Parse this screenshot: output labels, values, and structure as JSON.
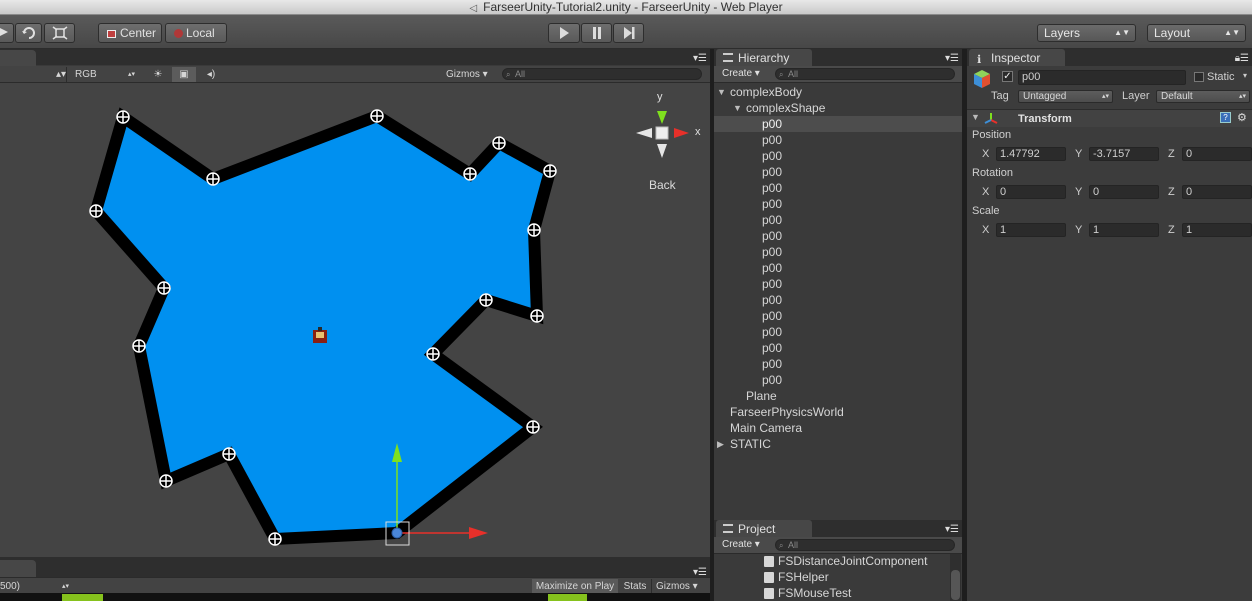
{
  "window": {
    "title": "FarseerUnity-Tutorial2.unity - FarseerUnity - Web Player"
  },
  "toolbar": {
    "pivot_center": "Center",
    "pivot_local": "Local",
    "layers": "Layers",
    "layout": "Layout"
  },
  "scene": {
    "render_mode": "RGB",
    "gizmos": "Gizmos",
    "search_placeholder": "All",
    "gizmo_y": "y",
    "gizmo_x": "x",
    "gizmo_view": "Back"
  },
  "game": {
    "resolution": "500)",
    "maximize": "Maximize on Play",
    "stats": "Stats",
    "gizmos": "Gizmos"
  },
  "hierarchy": {
    "title": "Hierarchy",
    "create": "Create",
    "search_placeholder": "All",
    "items": [
      {
        "label": "complexBody"
      },
      {
        "label": "complexShape"
      },
      {
        "label": "p00"
      },
      {
        "label": "p00"
      },
      {
        "label": "p00"
      },
      {
        "label": "p00"
      },
      {
        "label": "p00"
      },
      {
        "label": "p00"
      },
      {
        "label": "p00"
      },
      {
        "label": "p00"
      },
      {
        "label": "p00"
      },
      {
        "label": "p00"
      },
      {
        "label": "p00"
      },
      {
        "label": "p00"
      },
      {
        "label": "p00"
      },
      {
        "label": "p00"
      },
      {
        "label": "p00"
      },
      {
        "label": "p00"
      },
      {
        "label": "p00"
      },
      {
        "label": "Plane"
      },
      {
        "label": "FarseerPhysicsWorld"
      },
      {
        "label": "Main Camera"
      },
      {
        "label": "STATIC"
      }
    ]
  },
  "project": {
    "title": "Project",
    "create": "Create",
    "search_placeholder": "All",
    "items": [
      {
        "label": "FSDistanceJointComponent"
      },
      {
        "label": "FSHelper"
      },
      {
        "label": "FSMouseTest"
      }
    ]
  },
  "inspector": {
    "title": "Inspector",
    "object_name": "p00",
    "static_label": "Static",
    "tag_label": "Tag",
    "tag_value": "Untagged",
    "layer_label": "Layer",
    "layer_value": "Default",
    "transform_title": "Transform",
    "position_label": "Position",
    "rotation_label": "Rotation",
    "scale_label": "Scale",
    "axis_x": "X",
    "axis_y": "Y",
    "axis_z": "Z",
    "position": {
      "x": "1.47792",
      "y": "-3.7157",
      "z": "0"
    },
    "rotation": {
      "x": "0",
      "y": "0",
      "z": "0"
    },
    "scale": {
      "x": "1",
      "y": "1",
      "z": "1"
    }
  },
  "colors": {
    "shape_fill": "#0090f0",
    "shape_outline": "#000000",
    "gizmo_y": "#7fe01e",
    "gizmo_x": "#e8302a",
    "accent_green": "#86c21d"
  }
}
